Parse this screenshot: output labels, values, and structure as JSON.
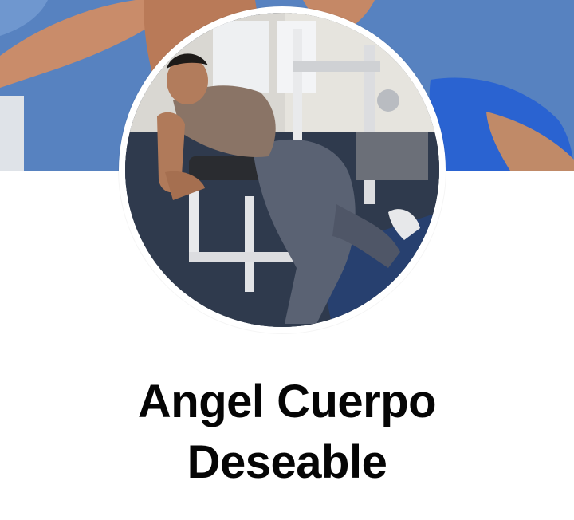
{
  "profile": {
    "name_line1": "Angel Cuerpo",
    "name_line2": "Deseable"
  },
  "colors": {
    "cover_background": "#5b86c4",
    "name_text": "#050505",
    "page_background": "#ffffff",
    "avatar_ring": "#ffffff"
  },
  "images": {
    "cover": "cover-photo",
    "avatar": "profile-photo-gym"
  }
}
